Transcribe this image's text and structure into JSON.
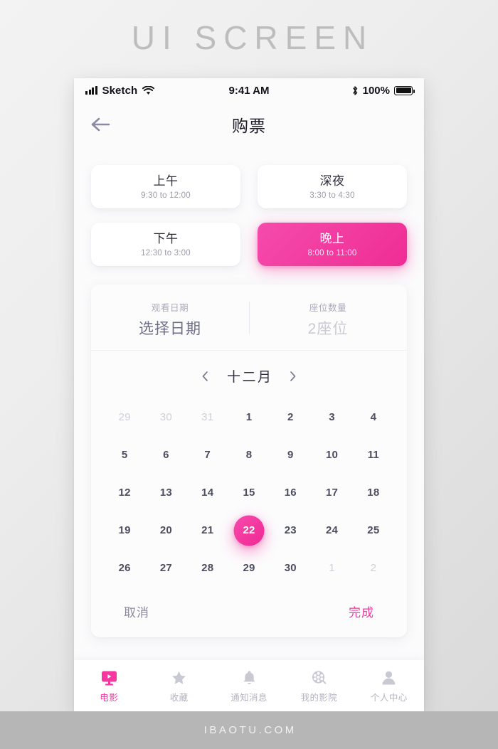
{
  "banner": {
    "title": "UI SCREEN"
  },
  "footer": {
    "text": "IBAOTU.COM"
  },
  "status_bar": {
    "carrier": "Sketch",
    "time": "9:41 AM",
    "battery_percent": "100%",
    "icons": [
      "signal-bars-icon",
      "wifi-icon",
      "bluetooth-icon",
      "battery-icon"
    ]
  },
  "header": {
    "title": "购票",
    "back_icon": "arrow-left-icon"
  },
  "slots": [
    {
      "name": "上午",
      "time": "9:30 to 12:00",
      "active": false
    },
    {
      "name": "深夜",
      "time": "3:30 to 4:30",
      "active": false
    },
    {
      "name": "下午",
      "time": "12:30 to 3:00",
      "active": false
    },
    {
      "name": "晚上",
      "time": "8:00 to 11:00",
      "active": true
    }
  ],
  "picker": {
    "date": {
      "label": "观看日期",
      "value": "选择日期"
    },
    "seats": {
      "label": "座位数量",
      "value": "2座位"
    },
    "month": {
      "label": "十二月",
      "prev_icon": "chevron-left-icon",
      "next_icon": "chevron-right-icon"
    },
    "actions": {
      "cancel": "取消",
      "done": "完成"
    }
  },
  "calendar": {
    "selected_day": 22,
    "weeks": [
      [
        {
          "d": "29",
          "out": true
        },
        {
          "d": "30",
          "out": true
        },
        {
          "d": "31",
          "out": true
        },
        {
          "d": "1"
        },
        {
          "d": "2"
        },
        {
          "d": "3"
        },
        {
          "d": "4"
        }
      ],
      [
        {
          "d": "5"
        },
        {
          "d": "6"
        },
        {
          "d": "7"
        },
        {
          "d": "8"
        },
        {
          "d": "9"
        },
        {
          "d": "10"
        },
        {
          "d": "11"
        }
      ],
      [
        {
          "d": "12"
        },
        {
          "d": "13"
        },
        {
          "d": "14"
        },
        {
          "d": "15"
        },
        {
          "d": "16"
        },
        {
          "d": "17"
        },
        {
          "d": "18"
        }
      ],
      [
        {
          "d": "19"
        },
        {
          "d": "20"
        },
        {
          "d": "21"
        },
        {
          "d": "22",
          "sel": true
        },
        {
          "d": "23"
        },
        {
          "d": "24"
        },
        {
          "d": "25"
        }
      ],
      [
        {
          "d": "26"
        },
        {
          "d": "27"
        },
        {
          "d": "28"
        },
        {
          "d": "29"
        },
        {
          "d": "30"
        },
        {
          "d": "1",
          "out": true
        },
        {
          "d": "2",
          "out": true
        }
      ]
    ]
  },
  "tabbar": [
    {
      "label": "电影",
      "icon": "monitor-play-icon",
      "active": true
    },
    {
      "label": "收藏",
      "icon": "star-icon",
      "active": false
    },
    {
      "label": "通知消息",
      "icon": "bell-icon",
      "active": false
    },
    {
      "label": "我的影院",
      "icon": "film-reel-icon",
      "active": false
    },
    {
      "label": "个人中心",
      "icon": "person-icon",
      "active": false
    }
  ],
  "colors": {
    "accent_pink": "#f7379f",
    "accent_pink_dark": "#ee2a93",
    "text_dark": "#2b2b38",
    "text_muted": "#9b9bab",
    "screen_bg": "#fbfbfc"
  }
}
